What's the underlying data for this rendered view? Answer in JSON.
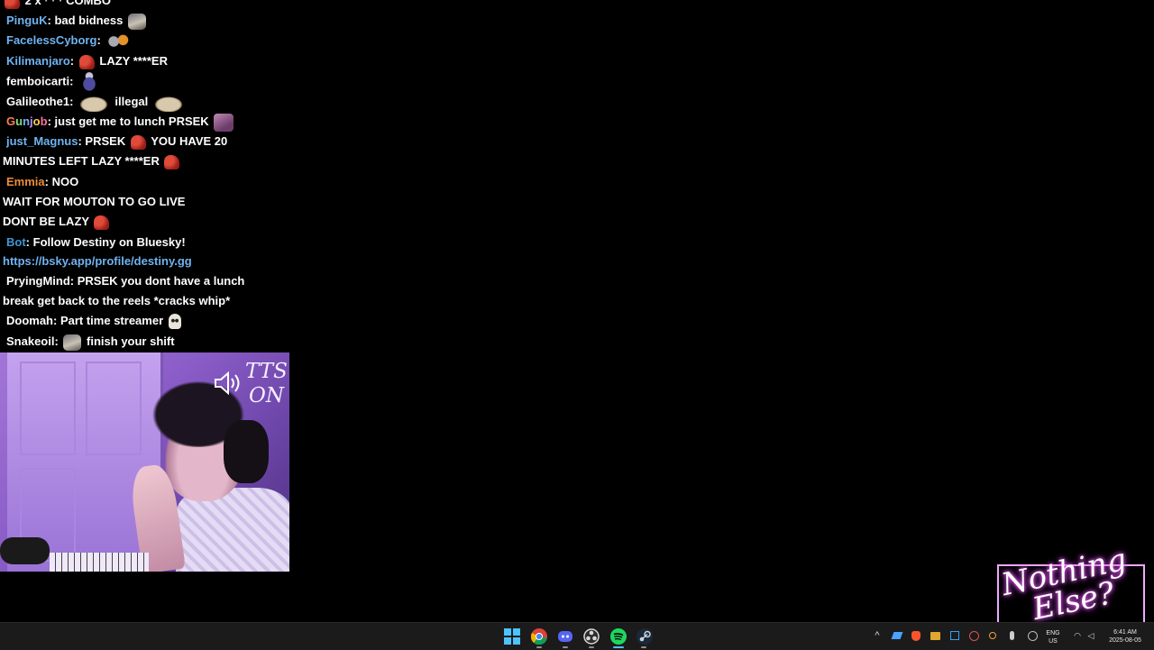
{
  "chat": {
    "partial_top": "2 x",
    "partial_combo": "COMBO",
    "messages": [
      {
        "user": "PinguK",
        "color": "#6fb3f0",
        "text": "bad bidness"
      },
      {
        "user": "FacelessCyborg",
        "color": "#6fb3f0",
        "text": ""
      },
      {
        "user": "Kilimanjaro",
        "color": "#6fb3f0",
        "text": "LAZY ****ER"
      },
      {
        "user": "femboicarti",
        "color": "#ffffff",
        "text": ""
      },
      {
        "user": "Galileothe1",
        "color": "#ffffff",
        "text": "illegal"
      },
      {
        "user": "Gunjob",
        "color": "#ffffff",
        "text": "just get me to lunch PRSEK"
      },
      {
        "user": "just_Magnus",
        "color": "#6fb3f0",
        "text": "PRSEK",
        "text2": "YOU HAVE 20",
        "cont": "MINUTES LEFT LAZY ****ER"
      },
      {
        "user": "Emmia",
        "color": "#ed8d3b",
        "text": "NOO",
        "cont": "WAIT FOR MOUTON TO GO LIVE",
        "cont2": "DONT BE LAZY"
      },
      {
        "user": "Bot",
        "color": "#3e98d6",
        "text": "Follow Destiny on Bluesky!",
        "link": "https://bsky.app/profile/destiny.gg"
      },
      {
        "user": "PryingMind",
        "color": "#ffffff",
        "text": "PRSEK you dont have a lunch",
        "cont": "break get back to the reels *cracks whip*"
      },
      {
        "user": "Doomah",
        "color": "#ffffff",
        "text": "Part time streamer"
      },
      {
        "user": "Snakeoil",
        "color": "#ffffff",
        "text": "finish your shift"
      }
    ]
  },
  "overlay": {
    "tts_line1": "TTS",
    "tts_line2": "ON",
    "brand_line1": "Nothing",
    "brand_line2": "Else?"
  },
  "taskbar": {
    "apps": [
      {
        "name": "Start",
        "icon": "windows-start-icon"
      },
      {
        "name": "Chrome",
        "icon": "chrome-icon"
      },
      {
        "name": "Discord",
        "icon": "discord-icon"
      },
      {
        "name": "OBS",
        "icon": "obs-icon"
      },
      {
        "name": "Spotify",
        "icon": "spotify-icon"
      },
      {
        "name": "Steam",
        "icon": "steam-icon"
      }
    ],
    "lang_top": "ENG",
    "lang_bottom": "US",
    "time": "6:41 AM",
    "date": "2025-08-05"
  },
  "colors": {
    "background": "#000000",
    "link": "#6fb3f0",
    "taskbar": "#1b1b1b",
    "accent": "#4cc2ff",
    "brand_glow": "#ff6cf8"
  }
}
